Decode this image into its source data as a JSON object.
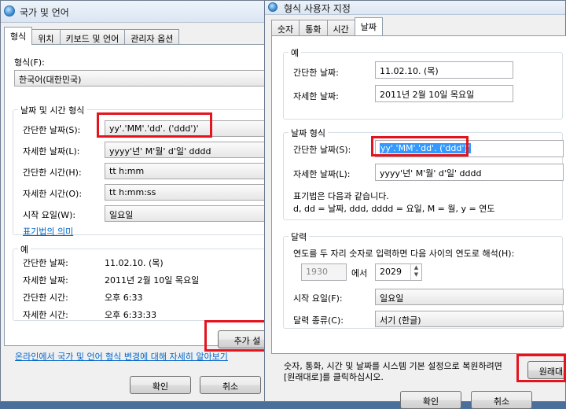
{
  "back_window": {
    "title": "국가 및 언어",
    "tabs": [
      "형식",
      "위치",
      "키보드 및 언어",
      "관리자 옵션"
    ],
    "format_label": "형식(F):",
    "format_value": "한국어(대한민국)",
    "datetime_group_title": "날짜 및 시간 형식",
    "rows": [
      {
        "label": "간단한 날짜(S):",
        "value": "yy'.'MM'.'dd'. ('ddd')'"
      },
      {
        "label": "자세한 날짜(L):",
        "value": "yyyy'년' M'월' d'일' dddd"
      },
      {
        "label": "간단한 시간(H):",
        "value": "tt h:mm"
      },
      {
        "label": "자세한 시간(O):",
        "value": "tt h:mm:ss"
      },
      {
        "label": "시작 요일(W):",
        "value": "일요일"
      }
    ],
    "notation_link": "표기법의 의미",
    "example_group_title": "예",
    "examples": [
      {
        "label": "간단한 날짜:",
        "value": "11.02.10. (목)"
      },
      {
        "label": "자세한 날짜:",
        "value": "2011년 2월 10일 목요일"
      },
      {
        "label": "간단한 시간:",
        "value": "오후 6:33"
      },
      {
        "label": "자세한 시간:",
        "value": "오후 6:33:33"
      }
    ],
    "additional_button": "추가 설",
    "online_link": "온라인에서 국가 및 언어 형식 변경에 대해 자세히 알아보기",
    "ok_button": "확인",
    "cancel_button": "취소"
  },
  "front_window": {
    "title": "형식 사용자 지정",
    "tabs": [
      "숫자",
      "통화",
      "시간",
      "날짜"
    ],
    "example_group_title": "예",
    "examples": [
      {
        "label": "간단한 날짜:",
        "value": "11.02.10. (목)"
      },
      {
        "label": "자세한 날짜:",
        "value": "2011년 2월 10일 목요일"
      }
    ],
    "date_format_group_title": "날짜 형식",
    "short_date_label": "간단한 날짜(S):",
    "short_date_value": "yy'.'MM'.'dd'. ('ddd')'",
    "long_date_label": "자세한 날짜(L):",
    "long_date_value": "yyyy'년' M'월' d'일' dddd",
    "notation_line1": "표기법은 다음과 같습니다.",
    "notation_line2": "d, dd = 날짜,  ddd, dddd = 요일,  M = 월,  y = 연도",
    "calendar_group_title": "달력",
    "two_digit_year_label": "연도를 두 자리 숫자로 입력하면 다음 사이의 연도로 해석(H):",
    "year_from": "1930",
    "between_word": "에서",
    "year_to": "2029",
    "first_day_label": "시작 요일(F):",
    "first_day_value": "일요일",
    "calendar_type_label": "달력 종류(C):",
    "calendar_type_value": "서기 (한글)",
    "reset_text_line1": "숫자, 통화, 시간 및 날짜를 시스템 기본 설정으로 복원하려면",
    "reset_text_line2": "[원래대로]를 클릭하십시오.",
    "reset_button": "원래대로",
    "ok_button": "확인",
    "cancel_button": "취소"
  },
  "colors": {
    "highlight_box": "#e3141e",
    "selection": "#3399ff",
    "link": "#0066cc"
  }
}
